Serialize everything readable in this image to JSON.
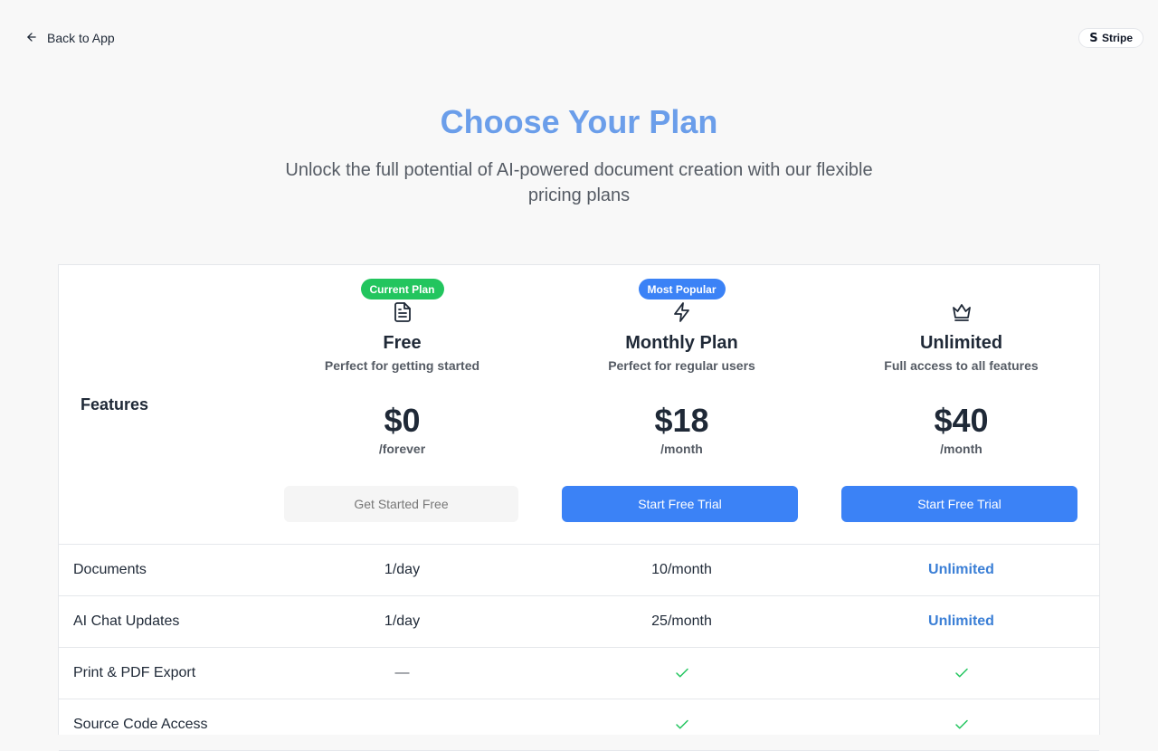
{
  "colors": {
    "accent": "#3b82f6",
    "title": "#6b9eea",
    "current_badge": "#22c55e",
    "check": "#22c55e",
    "unlimited_text": "#3b7fd6",
    "page_bg": "#f8f8f8"
  },
  "header": {
    "back_label": "Back to App",
    "back_icon": "arrow-left-icon",
    "stripe_label": "Stripe",
    "stripe_icon": "stripe-s-icon"
  },
  "hero": {
    "title": "Choose Your Plan",
    "subtitle": "Unlock the full potential of AI-powered document creation with our flexible pricing plans"
  },
  "table": {
    "features_heading": "Features",
    "plans": [
      {
        "badge": "Current Plan",
        "icon": "document-icon",
        "name": "Free",
        "description": "Perfect for getting started",
        "price": "$0",
        "period": "/forever",
        "button": "Get Started Free"
      },
      {
        "badge": "Most Popular",
        "icon": "lightning-icon",
        "name": "Monthly Plan",
        "description": "Perfect for regular users",
        "price": "$18",
        "period": "/month",
        "button": "Start Free Trial"
      },
      {
        "icon": "crown-icon",
        "name": "Unlimited",
        "description": "Full access to all features",
        "price": "$40",
        "period": "/month",
        "button": "Start Free Trial"
      }
    ],
    "features": [
      {
        "name": "Documents",
        "values": [
          "1/day",
          "10/month",
          "Unlimited"
        ]
      },
      {
        "name": "AI Chat Updates",
        "values": [
          "1/day",
          "25/month",
          "Unlimited"
        ]
      },
      {
        "name": "Print & PDF Export",
        "values": [
          "—",
          "check",
          "check"
        ]
      },
      {
        "name": "Source Code Access",
        "values": [
          "",
          "check",
          "check"
        ]
      }
    ]
  }
}
